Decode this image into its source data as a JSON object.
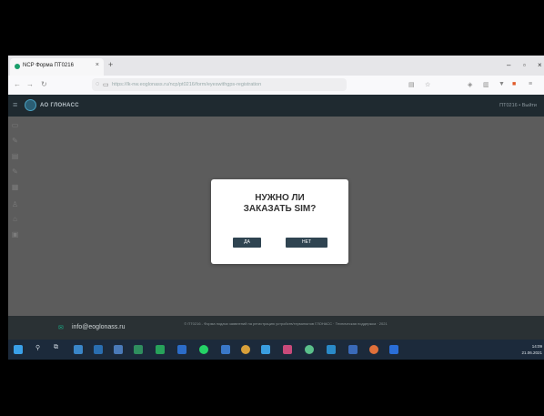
{
  "browser": {
    "tab_title": "NCP Форма ПТ0216",
    "tab_close": "×",
    "new_tab": "+",
    "url": "https://lk-nw.eoglonass.ru/ncp/pt0216/form/eyeswithgps-registration",
    "win_min": "–",
    "win_max": "▫",
    "win_close": "×"
  },
  "app": {
    "brand": "АО ГЛОНАСС",
    "user": "ПТ0216 • Выйти"
  },
  "modal": {
    "question_line1": "НУЖНО ЛИ",
    "question_line2": "ЗАКАЗАТЬ SIM?",
    "yes_label": "ДА",
    "no_label": "НЕТ"
  },
  "footer": {
    "email": "info@eoglonass.ru",
    "legal": "© ПТ0216 - Форма подачи заявлений на регистрацию устройств/терминалов ГЛОНАСС · Техническая поддержка · 2021"
  },
  "taskbar": {
    "time": "14:09",
    "date": "21.06.2021"
  }
}
